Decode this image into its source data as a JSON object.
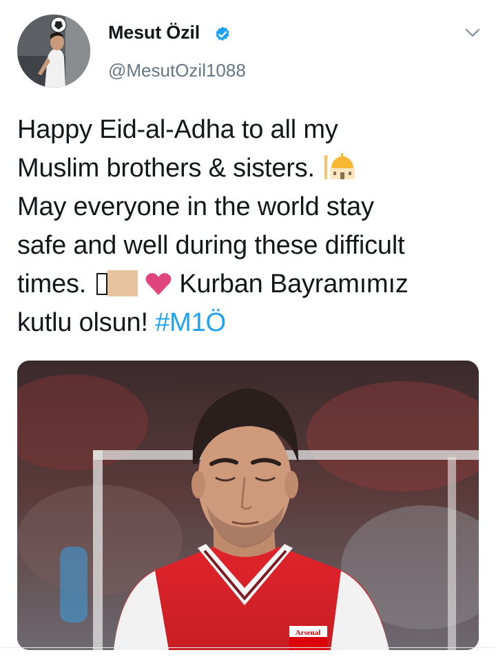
{
  "author": {
    "display_name": "Mesut Özil",
    "handle": "@MesutOzil1088",
    "verified": true
  },
  "tweet": {
    "line1": "Happy Eid-al-Adha to all my",
    "line2": "Muslim brothers & sisters.",
    "line3": "May everyone in the world stay",
    "line4": "safe and well during these difficult",
    "line5_start": "times.",
    "line5_end": "Kurban Bayramımız",
    "line6_start": "kutlu olsun!",
    "hashtag": "#M1Ö"
  },
  "media": {
    "crest_text": "Arsenal"
  },
  "icons": {
    "verified": "verified-badge-icon",
    "more": "chevron-down-icon",
    "mosque": "mosque-emoji-icon",
    "heart": "heart-emoji-icon"
  },
  "colors": {
    "link": "#1da1f2",
    "secondary_text": "#657786",
    "text": "#14171a",
    "verified": "#1da1f2",
    "heart": "#e0457b"
  }
}
